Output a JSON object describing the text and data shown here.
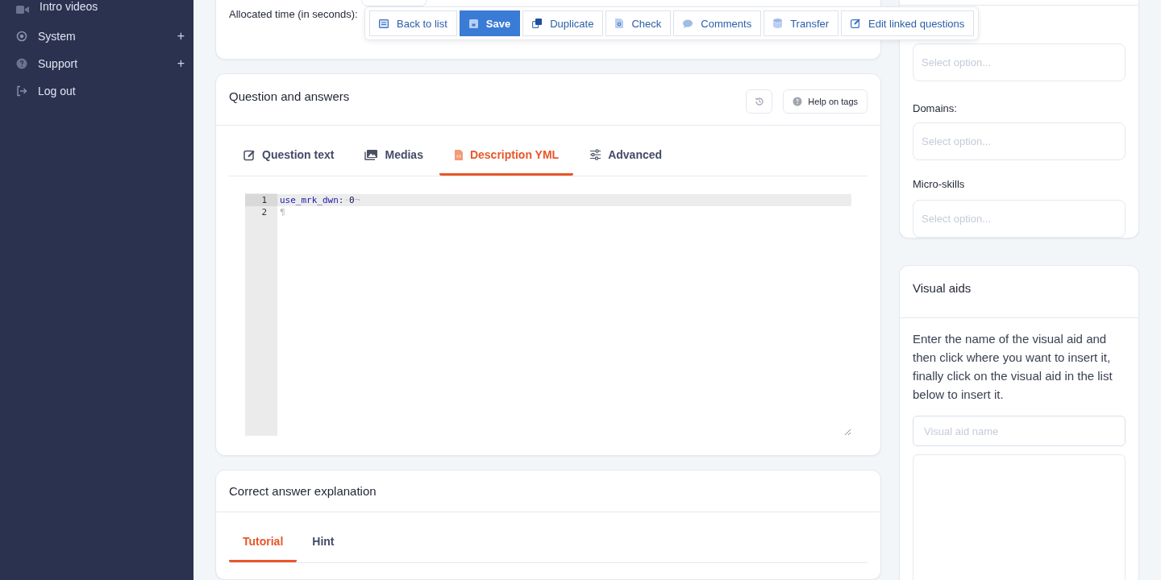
{
  "sidebar": {
    "items": [
      {
        "label": "Intro videos"
      },
      {
        "label": "System",
        "toggle": "+"
      },
      {
        "label": "Support",
        "toggle": "+"
      },
      {
        "label": "Log out"
      }
    ]
  },
  "settings_card": {
    "label": "Allocated time (in seconds):"
  },
  "toolbar": {
    "buttons": [
      {
        "label": "Back to list",
        "primary": false
      },
      {
        "label": "Save",
        "primary": true
      },
      {
        "label": "Duplicate",
        "primary": false
      },
      {
        "label": "Check",
        "primary": false
      },
      {
        "label": "Comments",
        "primary": false
      },
      {
        "label": "Transfer",
        "primary": false
      },
      {
        "label": "Edit linked questions",
        "primary": false
      }
    ]
  },
  "question_card": {
    "title": "Question and answers",
    "help_button": "Help on tags",
    "tabs": [
      {
        "label": "Question text",
        "selected": false
      },
      {
        "label": "Medias",
        "selected": false
      },
      {
        "label": "Description YML",
        "selected": true
      },
      {
        "label": "Advanced",
        "selected": false
      }
    ],
    "editor": {
      "lines": [
        {
          "number": "1",
          "active": true,
          "tokens": [
            {
              "text": "use_mrk_dwn:",
              "kind": "key"
            },
            {
              "text": "·",
              "kind": "invisible"
            },
            {
              "text": "0",
              "kind": "number"
            },
            {
              "text": "¬",
              "kind": "invisible"
            }
          ]
        },
        {
          "number": "2",
          "active": false,
          "tokens": [
            {
              "text": "¶",
              "kind": "invisible"
            }
          ]
        }
      ]
    }
  },
  "explanation_card": {
    "title": "Correct answer explanation",
    "tabs": [
      {
        "label": "Tutorial",
        "selected": true
      },
      {
        "label": "Hint",
        "selected": false
      }
    ]
  },
  "classification_card": {
    "fields": [
      {
        "placeholder": "Select option..."
      },
      {
        "label": "Domains:",
        "placeholder": "Select option..."
      },
      {
        "label": "Micro-skills",
        "placeholder": "Select option..."
      }
    ]
  },
  "visual_aids_card": {
    "title": "Visual aids",
    "description": "Enter the name of the visual aid and then click where you want to insert it, finally click on the visual aid in the list below to insert it.",
    "placeholder": "Visual aid name"
  }
}
